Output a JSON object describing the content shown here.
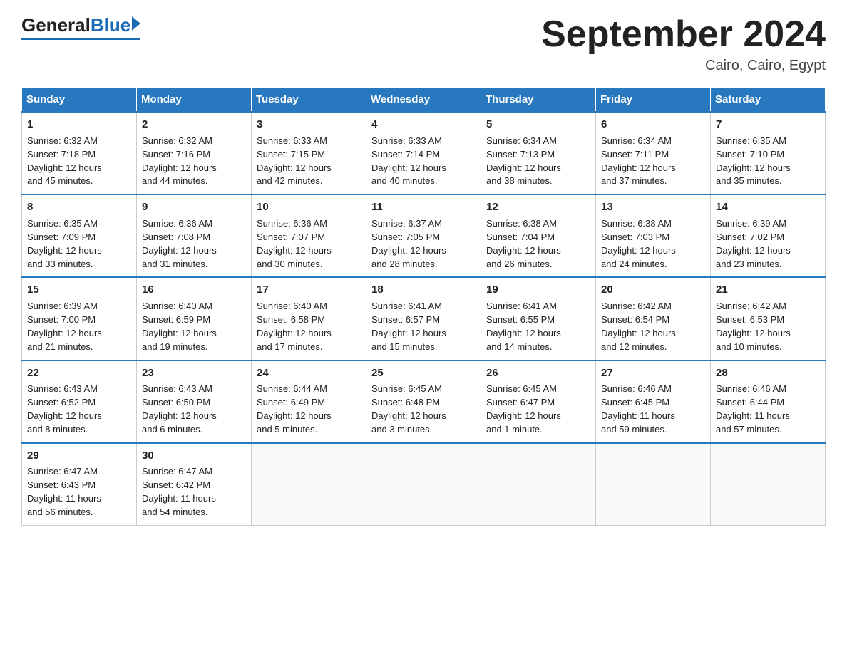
{
  "header": {
    "logo_general": "General",
    "logo_blue": "Blue",
    "month_title": "September 2024",
    "location": "Cairo, Cairo, Egypt"
  },
  "days_of_week": [
    "Sunday",
    "Monday",
    "Tuesday",
    "Wednesday",
    "Thursday",
    "Friday",
    "Saturday"
  ],
  "weeks": [
    [
      {
        "num": "1",
        "sunrise": "6:32 AM",
        "sunset": "7:18 PM",
        "daylight": "12 hours and 45 minutes."
      },
      {
        "num": "2",
        "sunrise": "6:32 AM",
        "sunset": "7:16 PM",
        "daylight": "12 hours and 44 minutes."
      },
      {
        "num": "3",
        "sunrise": "6:33 AM",
        "sunset": "7:15 PM",
        "daylight": "12 hours and 42 minutes."
      },
      {
        "num": "4",
        "sunrise": "6:33 AM",
        "sunset": "7:14 PM",
        "daylight": "12 hours and 40 minutes."
      },
      {
        "num": "5",
        "sunrise": "6:34 AM",
        "sunset": "7:13 PM",
        "daylight": "12 hours and 38 minutes."
      },
      {
        "num": "6",
        "sunrise": "6:34 AM",
        "sunset": "7:11 PM",
        "daylight": "12 hours and 37 minutes."
      },
      {
        "num": "7",
        "sunrise": "6:35 AM",
        "sunset": "7:10 PM",
        "daylight": "12 hours and 35 minutes."
      }
    ],
    [
      {
        "num": "8",
        "sunrise": "6:35 AM",
        "sunset": "7:09 PM",
        "daylight": "12 hours and 33 minutes."
      },
      {
        "num": "9",
        "sunrise": "6:36 AM",
        "sunset": "7:08 PM",
        "daylight": "12 hours and 31 minutes."
      },
      {
        "num": "10",
        "sunrise": "6:36 AM",
        "sunset": "7:07 PM",
        "daylight": "12 hours and 30 minutes."
      },
      {
        "num": "11",
        "sunrise": "6:37 AM",
        "sunset": "7:05 PM",
        "daylight": "12 hours and 28 minutes."
      },
      {
        "num": "12",
        "sunrise": "6:38 AM",
        "sunset": "7:04 PM",
        "daylight": "12 hours and 26 minutes."
      },
      {
        "num": "13",
        "sunrise": "6:38 AM",
        "sunset": "7:03 PM",
        "daylight": "12 hours and 24 minutes."
      },
      {
        "num": "14",
        "sunrise": "6:39 AM",
        "sunset": "7:02 PM",
        "daylight": "12 hours and 23 minutes."
      }
    ],
    [
      {
        "num": "15",
        "sunrise": "6:39 AM",
        "sunset": "7:00 PM",
        "daylight": "12 hours and 21 minutes."
      },
      {
        "num": "16",
        "sunrise": "6:40 AM",
        "sunset": "6:59 PM",
        "daylight": "12 hours and 19 minutes."
      },
      {
        "num": "17",
        "sunrise": "6:40 AM",
        "sunset": "6:58 PM",
        "daylight": "12 hours and 17 minutes."
      },
      {
        "num": "18",
        "sunrise": "6:41 AM",
        "sunset": "6:57 PM",
        "daylight": "12 hours and 15 minutes."
      },
      {
        "num": "19",
        "sunrise": "6:41 AM",
        "sunset": "6:55 PM",
        "daylight": "12 hours and 14 minutes."
      },
      {
        "num": "20",
        "sunrise": "6:42 AM",
        "sunset": "6:54 PM",
        "daylight": "12 hours and 12 minutes."
      },
      {
        "num": "21",
        "sunrise": "6:42 AM",
        "sunset": "6:53 PM",
        "daylight": "12 hours and 10 minutes."
      }
    ],
    [
      {
        "num": "22",
        "sunrise": "6:43 AM",
        "sunset": "6:52 PM",
        "daylight": "12 hours and 8 minutes."
      },
      {
        "num": "23",
        "sunrise": "6:43 AM",
        "sunset": "6:50 PM",
        "daylight": "12 hours and 6 minutes."
      },
      {
        "num": "24",
        "sunrise": "6:44 AM",
        "sunset": "6:49 PM",
        "daylight": "12 hours and 5 minutes."
      },
      {
        "num": "25",
        "sunrise": "6:45 AM",
        "sunset": "6:48 PM",
        "daylight": "12 hours and 3 minutes."
      },
      {
        "num": "26",
        "sunrise": "6:45 AM",
        "sunset": "6:47 PM",
        "daylight": "12 hours and 1 minute."
      },
      {
        "num": "27",
        "sunrise": "6:46 AM",
        "sunset": "6:45 PM",
        "daylight": "11 hours and 59 minutes."
      },
      {
        "num": "28",
        "sunrise": "6:46 AM",
        "sunset": "6:44 PM",
        "daylight": "11 hours and 57 minutes."
      }
    ],
    [
      {
        "num": "29",
        "sunrise": "6:47 AM",
        "sunset": "6:43 PM",
        "daylight": "11 hours and 56 minutes."
      },
      {
        "num": "30",
        "sunrise": "6:47 AM",
        "sunset": "6:42 PM",
        "daylight": "11 hours and 54 minutes."
      },
      null,
      null,
      null,
      null,
      null
    ]
  ],
  "labels": {
    "sunrise": "Sunrise:",
    "sunset": "Sunset:",
    "daylight": "Daylight:"
  }
}
